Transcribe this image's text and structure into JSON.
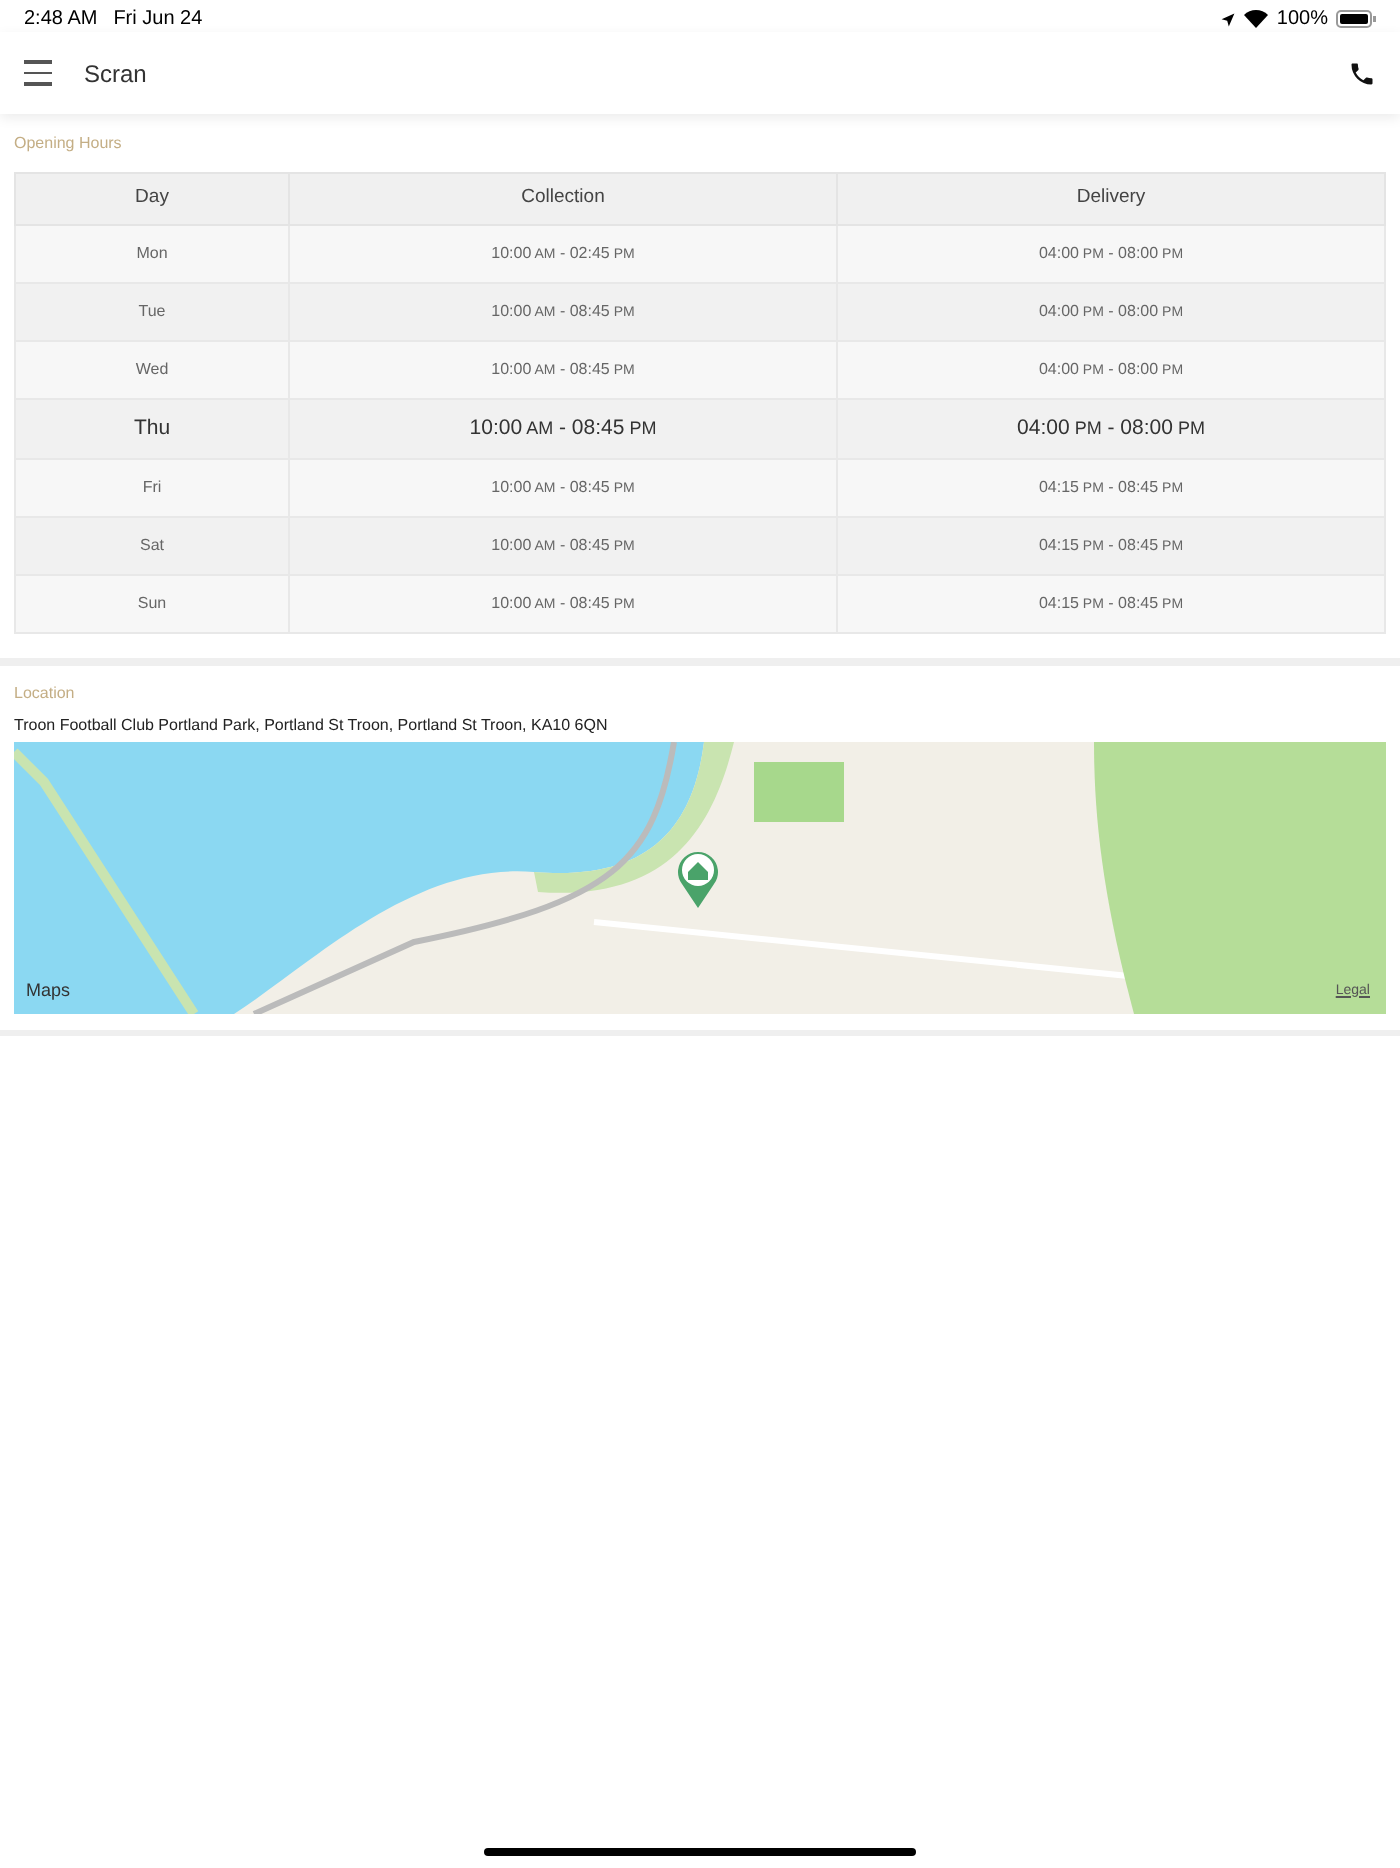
{
  "status_bar": {
    "time": "2:48 AM",
    "date": "Fri Jun 24",
    "battery": "100%"
  },
  "nav": {
    "title": "Scran"
  },
  "opening_hours": {
    "heading": "Opening Hours",
    "columns": [
      "Day",
      "Collection",
      "Delivery"
    ],
    "rows": [
      {
        "day": "Mon",
        "selected": false,
        "collection": {
          "start": "10:00",
          "start_period": "AM",
          "separator": "-",
          "end": "02:45",
          "end_period": "PM"
        },
        "delivery": {
          "start": "04:00",
          "start_period": "PM",
          "separator": "-",
          "end": "08:00",
          "end_period": "PM"
        }
      },
      {
        "day": "Tue",
        "selected": false,
        "collection": {
          "start": "10:00",
          "start_period": "AM",
          "separator": "-",
          "end": "08:45",
          "end_period": "PM"
        },
        "delivery": {
          "start": "04:00",
          "start_period": "PM",
          "separator": "-",
          "end": "08:00",
          "end_period": "PM"
        }
      },
      {
        "day": "Wed",
        "selected": false,
        "collection": {
          "start": "10:00",
          "start_period": "AM",
          "separator": "-",
          "end": "08:45",
          "end_period": "PM"
        },
        "delivery": {
          "start": "04:00",
          "start_period": "PM",
          "separator": "-",
          "end": "08:00",
          "end_period": "PM"
        }
      },
      {
        "day": "Thu",
        "selected": true,
        "collection": {
          "start": "10:00",
          "start_period": "AM",
          "separator": "-",
          "end": "08:45",
          "end_period": "PM"
        },
        "delivery": {
          "start": "04:00",
          "start_period": "PM",
          "separator": "-",
          "end": "08:00",
          "end_period": "PM"
        }
      },
      {
        "day": "Fri",
        "selected": false,
        "collection": {
          "start": "10:00",
          "start_period": "AM",
          "separator": "-",
          "end": "08:45",
          "end_period": "PM"
        },
        "delivery": {
          "start": "04:15",
          "start_period": "PM",
          "separator": "-",
          "end": "08:45",
          "end_period": "PM"
        }
      },
      {
        "day": "Sat",
        "selected": false,
        "collection": {
          "start": "10:00",
          "start_period": "AM",
          "separator": "-",
          "end": "08:45",
          "end_period": "PM"
        },
        "delivery": {
          "start": "04:15",
          "start_period": "PM",
          "separator": "-",
          "end": "08:45",
          "end_period": "PM"
        }
      },
      {
        "day": "Sun",
        "selected": false,
        "collection": {
          "start": "10:00",
          "start_period": "AM",
          "separator": "-",
          "end": "08:45",
          "end_period": "PM"
        },
        "delivery": {
          "start": "04:15",
          "start_period": "PM",
          "separator": "-",
          "end": "08:45",
          "end_period": "PM"
        }
      }
    ]
  },
  "location": {
    "heading": "Location",
    "address": "Troon Football Club Portland Park, Portland St Troon, Portland St Troon, KA10 6QN",
    "map": {
      "attribution": "Maps",
      "legal_link": "Legal"
    }
  }
}
